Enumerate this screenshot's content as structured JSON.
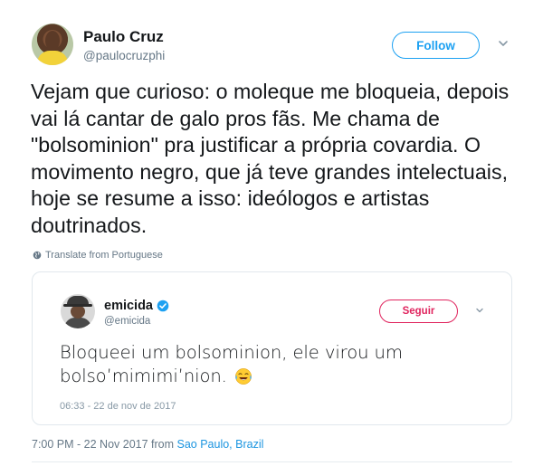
{
  "author": {
    "name": "Paulo Cruz",
    "handle": "@paulocruzphi",
    "follow_label": "Follow"
  },
  "tweet": {
    "text": "Vejam que curioso: o moleque me bloqueia, depois vai lá cantar de galo pros fãs. Me chama de \"bolsominion\" pra justificar a própria covardia. O movimento negro, que já teve grandes intelectuais, hoje se resume a isso: ideólogos e artistas doutrinados.",
    "translate_label": "Translate from Portuguese"
  },
  "quoted": {
    "name": "emicida",
    "handle": "@emicida",
    "follow_label": "Seguir",
    "text": "Bloqueei um bolsominion, ele virou um bolso’mimimi’nion.",
    "emoji": "face-with-tears-of-joy",
    "timestamp": "06:33 - 22 de nov de 2017"
  },
  "footer": {
    "timestamp": "7:00 PM - 22 Nov 2017 from ",
    "location": "Sao Paulo, Brazil"
  },
  "colors": {
    "brand_blue": "#1da1f2",
    "follow_red": "#e0245e",
    "muted": "#657786",
    "border": "#e1e8ed"
  },
  "icons": {
    "more": "chevron-down-icon",
    "translate": "globe-icon",
    "verified": "verified-badge-icon"
  }
}
